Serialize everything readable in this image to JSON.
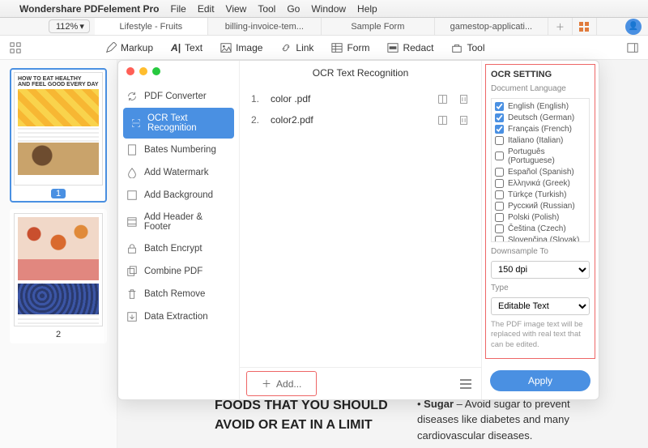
{
  "menu": {
    "app": "Wondershare PDFelement Pro",
    "items": [
      "File",
      "Edit",
      "View",
      "Tool",
      "Go",
      "Window",
      "Help"
    ]
  },
  "zoom": "112%",
  "tabs": [
    {
      "label": "Lifestyle - Fruits",
      "active": true
    },
    {
      "label": "billing-invoice-tem...",
      "active": false
    },
    {
      "label": "Sample Form",
      "active": false
    },
    {
      "label": "gamestop-applicati...",
      "active": false
    }
  ],
  "toolbar": [
    {
      "key": "markup",
      "label": "Markup"
    },
    {
      "key": "text",
      "label": "Text"
    },
    {
      "key": "image",
      "label": "Image"
    },
    {
      "key": "link",
      "label": "Link"
    },
    {
      "key": "form",
      "label": "Form"
    },
    {
      "key": "redact",
      "label": "Redact"
    },
    {
      "key": "tool",
      "label": "Tool"
    }
  ],
  "thumbnails": {
    "page1_h1": "HOW TO EAT HEALTHY",
    "page1_h2": "AND FEEL GOOD EVERY DAY",
    "p1": "1",
    "p2": "2"
  },
  "article": {
    "heading": "FOODS THAT YOU SHOULD AVOID OR EAT IN A LIMIT",
    "bullet_label": "Sugar",
    "bullet_text": " – Avoid sugar to prevent diseases like diabetes and many cardiovascular diseases."
  },
  "modal": {
    "title": "OCR Text Recognition",
    "side": [
      "PDF Converter",
      "OCR Text Recognition",
      "Bates Numbering",
      "Add Watermark",
      "Add Background",
      "Add Header & Footer",
      "Batch Encrypt",
      "Combine PDF",
      "Batch Remove",
      "Data Extraction"
    ],
    "side_selected": 1,
    "files": [
      {
        "n": "1.",
        "name": "color .pdf"
      },
      {
        "n": "2.",
        "name": "color2.pdf"
      }
    ],
    "add": "Add...",
    "apply": "Apply"
  },
  "ocr": {
    "heading": "OCR SETTING",
    "lang_label": "Document Language",
    "languages": [
      {
        "label": "English (English)",
        "checked": true
      },
      {
        "label": "Deutsch (German)",
        "checked": true
      },
      {
        "label": "Français (French)",
        "checked": true
      },
      {
        "label": "Italiano (Italian)",
        "checked": false
      },
      {
        "label": "Português (Portuguese)",
        "checked": false
      },
      {
        "label": "Español (Spanish)",
        "checked": false
      },
      {
        "label": "Ελληνικά (Greek)",
        "checked": false
      },
      {
        "label": "Türkçe (Turkish)",
        "checked": false
      },
      {
        "label": "Русский (Russian)",
        "checked": false
      },
      {
        "label": "Polski (Polish)",
        "checked": false
      },
      {
        "label": "Čeština (Czech)",
        "checked": false
      },
      {
        "label": "Slovenčina (Slovak)",
        "checked": false
      }
    ],
    "downsample_label": "Downsample To",
    "downsample_value": "150 dpi",
    "type_label": "Type",
    "type_value": "Editable Text",
    "type_hint": "The PDF image text will be replaced with real text that can be edited."
  }
}
